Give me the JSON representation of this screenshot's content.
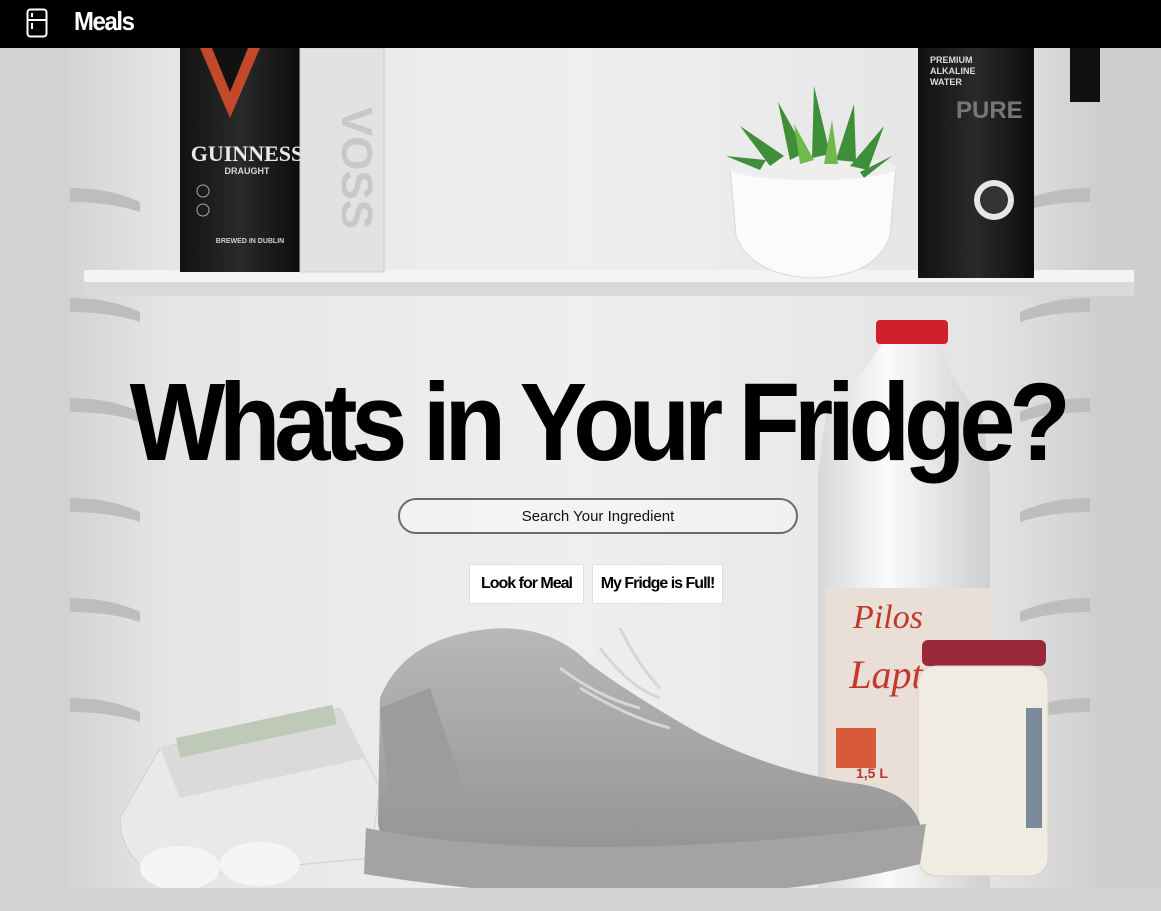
{
  "navbar": {
    "icon": "fridge-icon",
    "brand": "Meals"
  },
  "hero": {
    "headline": "Whats in Your Fridge?",
    "search_placeholder": "Search Your Ingredient",
    "look_button": "Look for Meal",
    "full_button": "My Fridge is Full!"
  },
  "background": {
    "guinness_brand": "GUINNESS",
    "guinness_sub": "DRAUGHT",
    "guinness_footer": "BREWED IN DUBLIN",
    "water_line1": "PREMIUM",
    "water_line2": "ALKALINE",
    "water_line3": "WATER",
    "water_big": "PURE",
    "milk_brand": "Pilos",
    "milk_product": "Lapt",
    "milk_volume": "1,5 L"
  },
  "colors": {
    "navbar_bg": "#000000",
    "cap_red": "#d0202e"
  }
}
